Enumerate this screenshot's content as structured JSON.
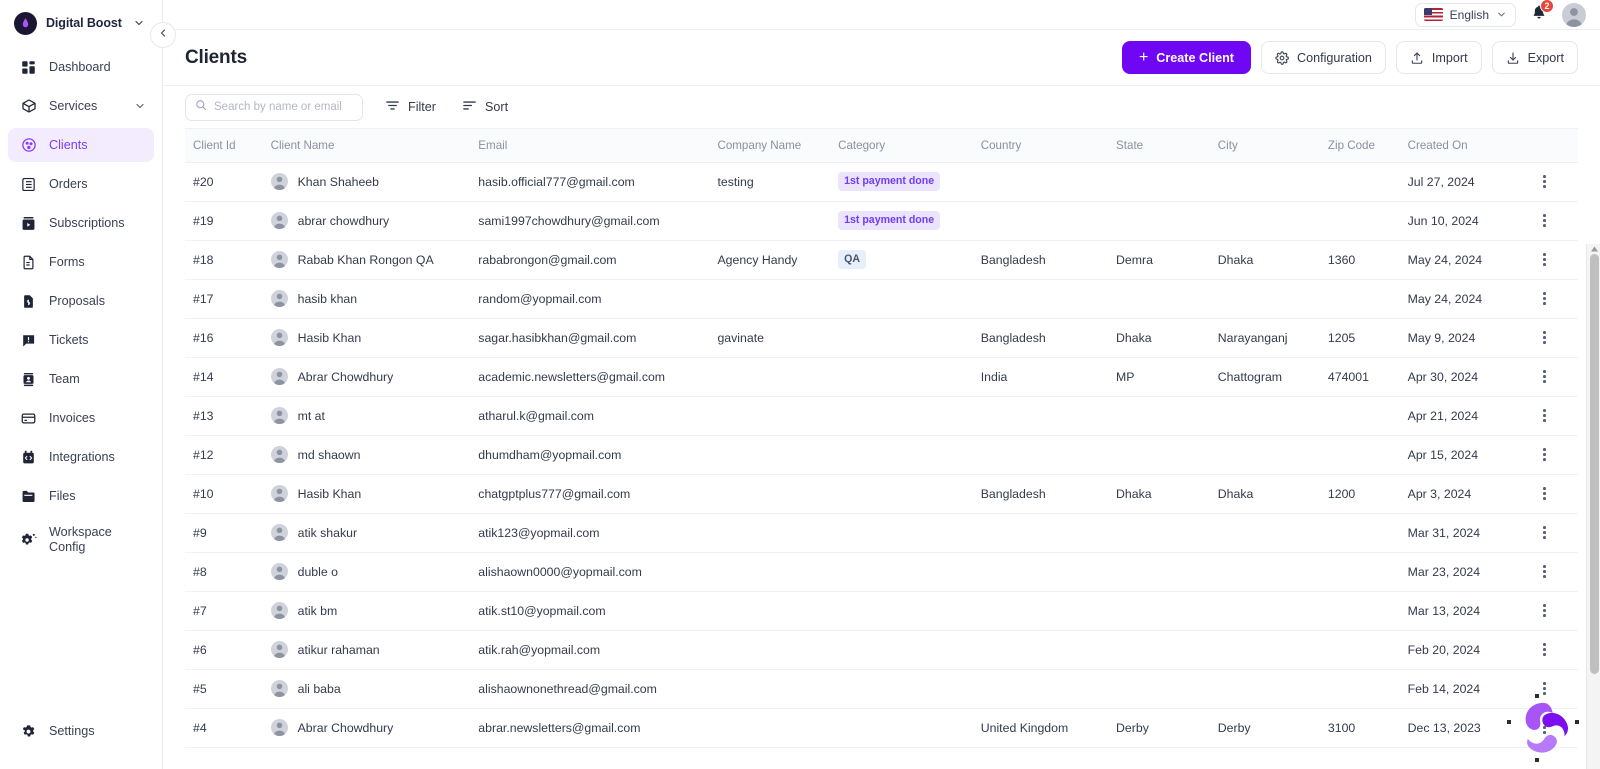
{
  "brand": {
    "name": "Digital Boost",
    "caret_icon": "chevron-down-icon",
    "logo_icon": "brand-logo-icon"
  },
  "sidebar": {
    "collapse_icon": "chevron-left-icon",
    "items": [
      {
        "label": "Dashboard",
        "icon": "dashboard-icon",
        "active": false,
        "caret": false
      },
      {
        "label": "Services",
        "icon": "package-icon",
        "active": false,
        "caret": true
      },
      {
        "label": "Clients",
        "icon": "clients-icon",
        "active": true,
        "caret": false
      },
      {
        "label": "Orders",
        "icon": "orders-icon",
        "active": false,
        "caret": false
      },
      {
        "label": "Subscriptions",
        "icon": "subscriptions-icon",
        "active": false,
        "caret": false
      },
      {
        "label": "Forms",
        "icon": "forms-icon",
        "active": false,
        "caret": false
      },
      {
        "label": "Proposals",
        "icon": "proposals-icon",
        "active": false,
        "caret": false
      },
      {
        "label": "Tickets",
        "icon": "tickets-icon",
        "active": false,
        "caret": false
      },
      {
        "label": "Team",
        "icon": "team-icon",
        "active": false,
        "caret": false
      },
      {
        "label": "Invoices",
        "icon": "invoices-icon",
        "active": false,
        "caret": false
      },
      {
        "label": "Integrations",
        "icon": "integrations-icon",
        "active": false,
        "caret": false
      },
      {
        "label": "Files",
        "icon": "files-icon",
        "active": false,
        "caret": false
      },
      {
        "label": "Workspace Config",
        "icon": "workspace-config-icon",
        "active": false,
        "caret": false
      }
    ],
    "settings": {
      "label": "Settings",
      "icon": "gear-icon"
    }
  },
  "topbar": {
    "language": {
      "label": "English",
      "flag": "us-flag-icon",
      "caret_icon": "chevron-down-icon"
    },
    "notifications": {
      "icon": "bell-icon",
      "count": "2"
    },
    "avatar_icon": "user-avatar-icon"
  },
  "header": {
    "title": "Clients",
    "buttons": [
      {
        "label": "Create Client",
        "icon": "plus-icon",
        "style": "primary"
      },
      {
        "label": "Configuration",
        "icon": "gear-icon",
        "style": "default"
      },
      {
        "label": "Import",
        "icon": "upload-icon",
        "style": "default"
      },
      {
        "label": "Export",
        "icon": "download-icon",
        "style": "default"
      }
    ]
  },
  "toolbar": {
    "search_placeholder": "Search by name or email",
    "search_value": "",
    "search_icon": "search-icon",
    "filter_label": "Filter",
    "filter_icon": "filter-icon",
    "sort_label": "Sort",
    "sort_icon": "sort-icon"
  },
  "table": {
    "columns": [
      "Client Id",
      "Client Name",
      "Email",
      "Company Name",
      "Category",
      "Country",
      "State",
      "City",
      "Zip Code",
      "Created On"
    ],
    "rows": [
      {
        "id": "#20",
        "name": "Khan Shaheeb",
        "email": "hasib.official777@gmail.com",
        "company": "testing",
        "category": "1st payment done",
        "category_type": "payment",
        "country": "",
        "state": "",
        "city": "",
        "zip": "",
        "created": "Jul 27, 2024"
      },
      {
        "id": "#19",
        "name": "abrar chowdhury",
        "email": "sami1997chowdhury@gmail.com",
        "company": "",
        "category": "1st payment done",
        "category_type": "payment",
        "country": "",
        "state": "",
        "city": "",
        "zip": "",
        "created": "Jun 10, 2024"
      },
      {
        "id": "#18",
        "name": "Rabab Khan Rongon QA",
        "email": "rababrongon@gmail.com",
        "company": "Agency Handy",
        "category": "QA",
        "category_type": "qa",
        "country": "Bangladesh",
        "state": "Demra",
        "city": "Dhaka",
        "zip": "1360",
        "created": "May 24, 2024"
      },
      {
        "id": "#17",
        "name": "hasib khan",
        "email": "random@yopmail.com",
        "company": "",
        "category": "",
        "category_type": "",
        "country": "",
        "state": "",
        "city": "",
        "zip": "",
        "created": "May 24, 2024"
      },
      {
        "id": "#16",
        "name": "Hasib Khan",
        "email": "sagar.hasibkhan@gmail.com",
        "company": "gavinate",
        "category": "",
        "category_type": "",
        "country": "Bangladesh",
        "state": "Dhaka",
        "city": "Narayanganj",
        "zip": "1205",
        "created": "May 9, 2024"
      },
      {
        "id": "#14",
        "name": "Abrar Chowdhury",
        "email": "academic.newsletters@gmail.com",
        "company": "",
        "category": "",
        "category_type": "",
        "country": "India",
        "state": "MP",
        "city": "Chattogram",
        "zip": "474001",
        "created": "Apr 30, 2024"
      },
      {
        "id": "#13",
        "name": "mt at",
        "email": "atharul.k@gmail.com",
        "company": "",
        "category": "",
        "category_type": "",
        "country": "",
        "state": "",
        "city": "",
        "zip": "",
        "created": "Apr 21, 2024"
      },
      {
        "id": "#12",
        "name": "md shaown",
        "email": "dhumdham@yopmail.com",
        "company": "",
        "category": "",
        "category_type": "",
        "country": "",
        "state": "",
        "city": "",
        "zip": "",
        "created": "Apr 15, 2024"
      },
      {
        "id": "#10",
        "name": "Hasib Khan",
        "email": "chatgptplus777@gmail.com",
        "company": "",
        "category": "",
        "category_type": "",
        "country": "Bangladesh",
        "state": "Dhaka",
        "city": "Dhaka",
        "zip": "1200",
        "created": "Apr 3, 2024"
      },
      {
        "id": "#9",
        "name": "atik shakur",
        "email": "atik123@yopmail.com",
        "company": "",
        "category": "",
        "category_type": "",
        "country": "",
        "state": "",
        "city": "",
        "zip": "",
        "created": "Mar 31, 2024"
      },
      {
        "id": "#8",
        "name": "duble o",
        "email": "alishaown0000@yopmail.com",
        "company": "",
        "category": "",
        "category_type": "",
        "country": "",
        "state": "",
        "city": "",
        "zip": "",
        "created": "Mar 23, 2024"
      },
      {
        "id": "#7",
        "name": "atik bm",
        "email": "atik.st10@yopmail.com",
        "company": "",
        "category": "",
        "category_type": "",
        "country": "",
        "state": "",
        "city": "",
        "zip": "",
        "created": "Mar 13, 2024"
      },
      {
        "id": "#6",
        "name": "atikur rahaman",
        "email": "atik.rah@yopmail.com",
        "company": "",
        "category": "",
        "category_type": "",
        "country": "",
        "state": "",
        "city": "",
        "zip": "",
        "created": "Feb 20, 2024"
      },
      {
        "id": "#5",
        "name": "ali baba",
        "email": "alishaownonethread@gmail.com",
        "company": "",
        "category": "",
        "category_type": "",
        "country": "",
        "state": "",
        "city": "",
        "zip": "",
        "created": "Feb 14, 2024"
      },
      {
        "id": "#4",
        "name": "Abrar Chowdhury",
        "email": "abrar.newsletters@gmail.com",
        "company": "",
        "category": "",
        "category_type": "",
        "country": "United Kingdom",
        "state": "Derby",
        "city": "Derby",
        "zip": "3100",
        "created": "Dec 13, 2023"
      }
    ],
    "row_menu_icon": "kebab-menu-icon"
  },
  "chat_widget": {
    "icon": "chat-widget-logo-icon"
  },
  "colors": {
    "accent": "#6f07f5",
    "accent_soft_bg": "#f3ebfe",
    "badge_payment_bg": "#ece4fe",
    "badge_payment_text": "#6f3df5",
    "badge_qa_bg": "#e7eefc",
    "badge_qa_text": "#4a5468",
    "notification_badge": "#e8453c"
  }
}
